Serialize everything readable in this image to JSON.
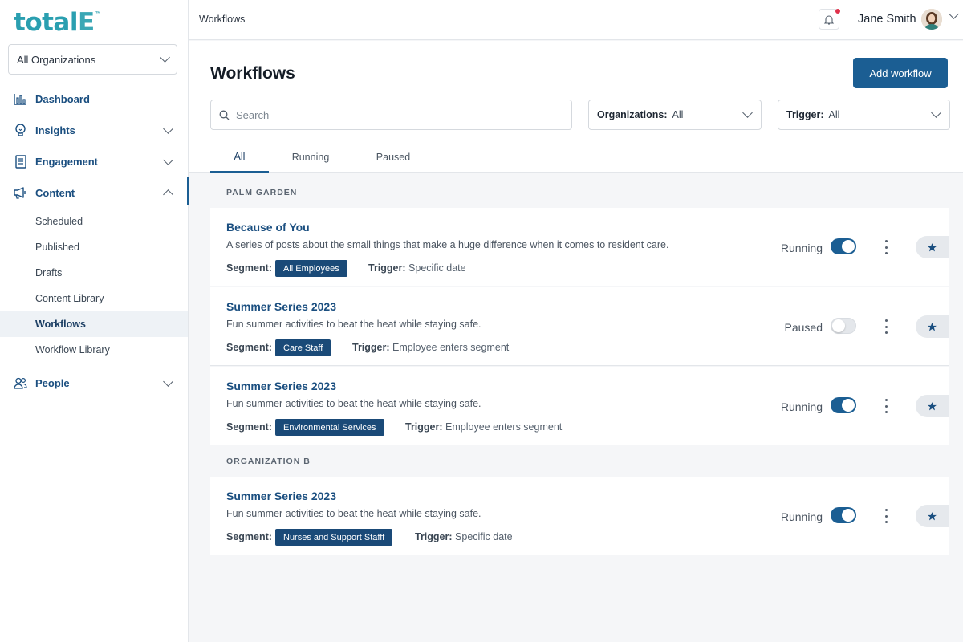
{
  "brand": {
    "logo_main": "total",
    "logo_accent": "E",
    "logo_tm": "™"
  },
  "org_selector": {
    "value": "All Organizations"
  },
  "sidebar": {
    "items": [
      {
        "label": "Dashboard",
        "icon": "bar-chart-icon"
      },
      {
        "label": "Insights",
        "icon": "lightbulb-icon"
      },
      {
        "label": "Engagement",
        "icon": "clipboard-icon"
      },
      {
        "label": "Content",
        "icon": "megaphone-icon"
      },
      {
        "label": "People",
        "icon": "people-icon"
      }
    ],
    "content_sub": [
      "Scheduled",
      "Published",
      "Drafts",
      "Content Library",
      "Workflows",
      "Workflow Library"
    ]
  },
  "topbar": {
    "breadcrumb": "Workflows",
    "user_name": "Jane Smith"
  },
  "page": {
    "title": "Workflows",
    "add_button": "Add workflow",
    "search_placeholder": "Search",
    "filters": {
      "org_label": "Organizations:",
      "org_value": "All",
      "trigger_label": "Trigger:",
      "trigger_value": "All"
    },
    "tabs": [
      "All",
      "Running",
      "Paused"
    ]
  },
  "groups": [
    {
      "name": "PALM GARDEN"
    },
    {
      "name": "ORGANIZATION B"
    }
  ],
  "workflows": [
    {
      "title": "Because of You",
      "description": "A series of posts about the small things that make a huge difference when it comes to resident care.",
      "segment_label": "Segment:",
      "segment": "All Employees",
      "trigger_label": "Trigger:",
      "trigger": "Specific date",
      "status": "Running",
      "enabled": true
    },
    {
      "title": "Summer Series 2023",
      "description": "Fun summer activities to beat the heat while staying safe.",
      "segment_label": "Segment:",
      "segment": "Care Staff",
      "trigger_label": "Trigger:",
      "trigger": "Employee enters segment",
      "status": "Paused",
      "enabled": false
    },
    {
      "title": "Summer Series 2023",
      "description": "Fun summer activities to beat the heat while staying safe.",
      "segment_label": "Segment:",
      "segment": "Environmental Services",
      "trigger_label": "Trigger:",
      "trigger": "Employee enters segment",
      "status": "Running",
      "enabled": true
    },
    {
      "title": "Summer Series 2023",
      "description": "Fun summer activities to beat the heat while staying safe.",
      "segment_label": "Segment:",
      "segment": "Nurses and Support Stafff",
      "trigger_label": "Trigger:",
      "trigger": "Specific date",
      "status": "Running",
      "enabled": true
    }
  ],
  "colors": {
    "primary": "#1b5e93",
    "brand_teal": "#2a9fb0",
    "badge": "#1a4a78",
    "notification": "#e0314b"
  }
}
